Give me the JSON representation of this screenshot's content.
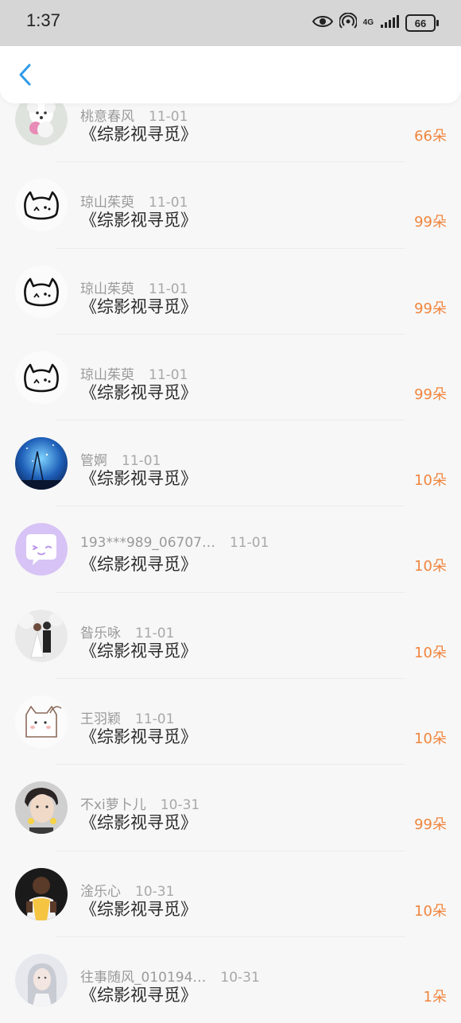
{
  "status_bar": {
    "time": "1:37",
    "network_label": "4G",
    "battery": "66",
    "icons": [
      "eye-icon",
      "hotspot-icon",
      "signal-icon",
      "battery-icon"
    ]
  },
  "header": {
    "back_icon": "chevron-left-icon",
    "accent_color": "#2f9be8"
  },
  "colors": {
    "count": "#f0853e",
    "username": "#9a9a9a",
    "title": "#2a2a2a"
  },
  "list": [
    {
      "user": "桃意春风",
      "date": "11-01",
      "title": "《综影视寻觅》",
      "count": "66朵",
      "avatar": "puppy-avatar"
    },
    {
      "user": "琼山茱萸",
      "date": "11-01",
      "title": "《综影视寻觅》",
      "count": "99朵",
      "avatar": "cat-sketch-avatar"
    },
    {
      "user": "琼山茱萸",
      "date": "11-01",
      "title": "《综影视寻觅》",
      "count": "99朵",
      "avatar": "cat-sketch-avatar"
    },
    {
      "user": "琼山茱萸",
      "date": "11-01",
      "title": "《综影视寻觅》",
      "count": "99朵",
      "avatar": "cat-sketch-avatar"
    },
    {
      "user": "管婀",
      "date": "11-01",
      "title": "《综影视寻觅》",
      "count": "10朵",
      "avatar": "night-sky-avatar"
    },
    {
      "user": "193***989_06707…",
      "date": "11-01",
      "title": "《综影视寻觅》",
      "count": "10朵",
      "avatar": "chat-bubble-avatar"
    },
    {
      "user": "昝乐咏",
      "date": "11-01",
      "title": "《综影视寻觅》",
      "count": "10朵",
      "avatar": "couple-photo-avatar"
    },
    {
      "user": "王羽颖",
      "date": "11-01",
      "title": "《综影视寻觅》",
      "count": "10朵",
      "avatar": "cartoon-cat-avatar"
    },
    {
      "user": "不xi萝卜儿",
      "date": "10-31",
      "title": "《综影视寻觅》",
      "count": "99朵",
      "avatar": "boy-photo-avatar"
    },
    {
      "user": "淦乐心",
      "date": "10-31",
      "title": "《综影视寻觅》",
      "count": "10朵",
      "avatar": "basketball-player-avatar"
    },
    {
      "user": "往事随风_010194…",
      "date": "10-31",
      "title": "《综影视寻觅》",
      "count": "1朵",
      "avatar": "girl-photo-avatar"
    }
  ]
}
